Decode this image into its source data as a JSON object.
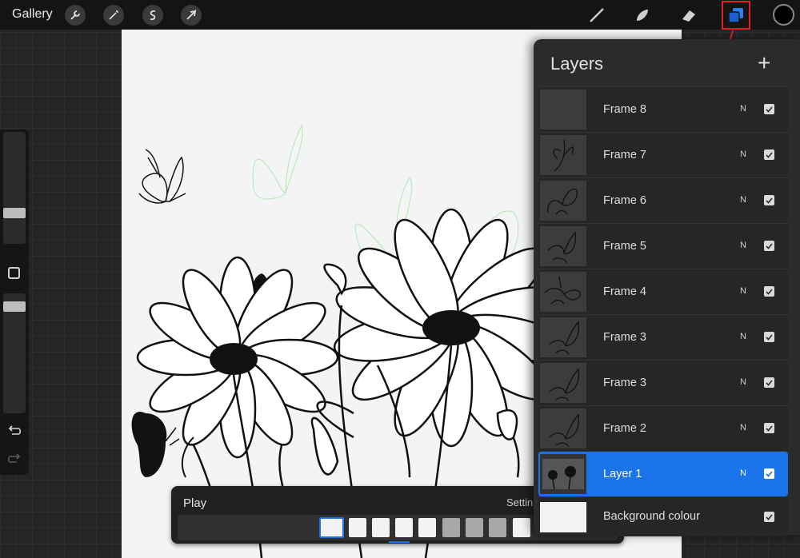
{
  "topbar": {
    "gallery_label": "Gallery",
    "left_tools": [
      "wrench-icon",
      "magic-wand-icon",
      "selection-icon",
      "transform-arrow-icon"
    ],
    "right_tools": [
      "brush-icon",
      "smudge-icon",
      "eraser-icon",
      "layers-icon"
    ],
    "color_swatch": "#000000",
    "highlight_color": "#e02020"
  },
  "layers_panel": {
    "title": "Layers",
    "add_label": "+",
    "layers": [
      {
        "name": "Frame 8",
        "blend": "N",
        "visible": true
      },
      {
        "name": "Frame 7",
        "blend": "N",
        "visible": true
      },
      {
        "name": "Frame 6",
        "blend": "N",
        "visible": true
      },
      {
        "name": "Frame 5",
        "blend": "N",
        "visible": true
      },
      {
        "name": "Frame 4",
        "blend": "N",
        "visible": true
      },
      {
        "name": "Frame 3",
        "blend": "N",
        "visible": true
      },
      {
        "name": "Frame 3",
        "blend": "N",
        "visible": true
      },
      {
        "name": "Frame 2",
        "blend": "N",
        "visible": true
      },
      {
        "name": "Layer 1",
        "blend": "N",
        "visible": true,
        "selected": true
      },
      {
        "name": "Background colour",
        "visible": true
      }
    ]
  },
  "playbar": {
    "play_label": "Play",
    "settings_label": "Settin"
  },
  "colors": {
    "accent": "#1a73e8",
    "annotation": "#e02020"
  }
}
